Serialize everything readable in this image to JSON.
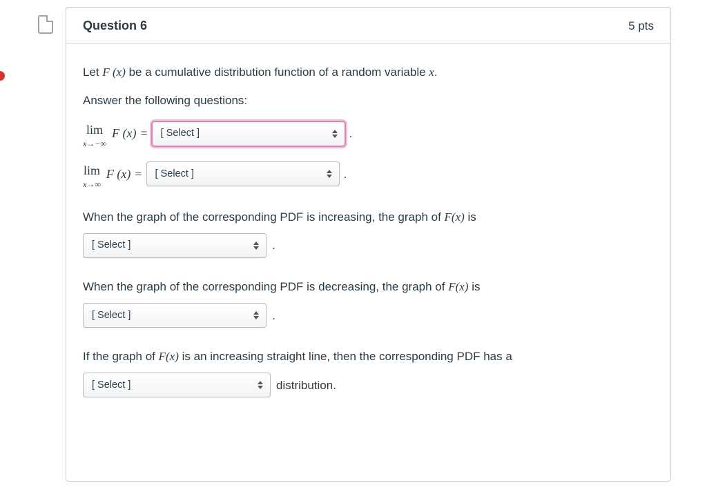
{
  "header": {
    "title": "Question 6",
    "points": "5 pts"
  },
  "body": {
    "intro1_pre": "Let ",
    "intro1_post": " be a cumulative distribution function of a random variable ",
    "intro2": "Answer the following questions:",
    "limit_neg_label_top": "lim",
    "limit_neg_label_bot": "x→−∞",
    "limit_pos_label_top": "lim",
    "limit_pos_label_bot": "x→∞",
    "Fx": "F (x)",
    "equals": "=",
    "period": ".",
    "q3_pre": "When the graph of the corresponding PDF is increasing, the graph of ",
    "q3_post": " is",
    "q4_pre": "When the graph of the corresponding PDF is decreasing, the graph of ",
    "q4_post": " is",
    "q5_pre": "If the graph of ",
    "q5_mid": " is an increasing straight line, then the corresponding PDF has a",
    "q5_tail": " distribution.",
    "Fx_inline": "F(x)",
    "x_var": "x"
  },
  "select": {
    "placeholder": "[ Select ]"
  }
}
